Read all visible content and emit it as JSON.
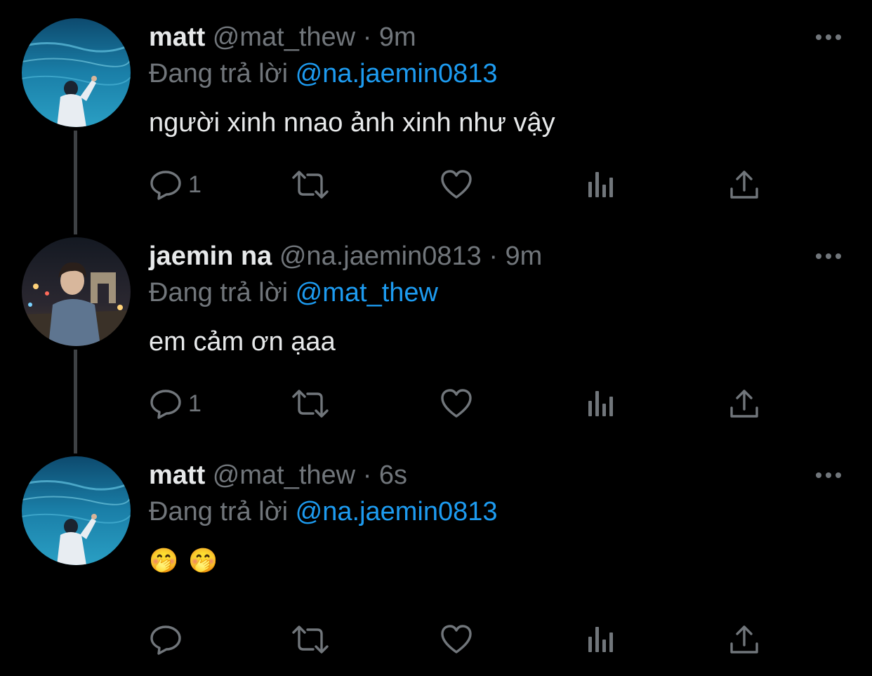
{
  "tweets": [
    {
      "display_name": "matt",
      "handle": "@mat_thew",
      "separator": "·",
      "time": "9m",
      "reply_prefix": "Đang trả lời",
      "reply_to": "@na.jaemin0813",
      "text": "người xinh nnao ảnh xinh như vậy",
      "reply_count": "1",
      "avatar": "ocean-aquarium-photo"
    },
    {
      "display_name": "jaemin na",
      "handle": "@na.jaemin0813",
      "separator": "·",
      "time": "9m",
      "reply_prefix": "Đang trả lời",
      "reply_to": "@mat_thew",
      "text": "em cảm ơn ạaa",
      "reply_count": "1",
      "avatar": "night-city-portrait-photo"
    },
    {
      "display_name": "matt",
      "handle": "@mat_thew",
      "separator": "·",
      "time": "6s",
      "reply_prefix": "Đang trả lời",
      "reply_to": "@na.jaemin0813",
      "text": "🤭🤭",
      "reply_count": "",
      "avatar": "ocean-aquarium-photo"
    }
  ],
  "icons": {
    "reply": "reply-bubble-icon",
    "retweet": "retweet-icon",
    "like": "heart-icon",
    "views": "views-bar-chart-icon",
    "share": "share-upload-icon",
    "more": "more-dots-icon"
  },
  "colors": {
    "background": "#000000",
    "primary_text": "#e7e9ea",
    "secondary_text": "#71767b",
    "link": "#1d9bf0",
    "thread_line": "#3e4144"
  }
}
